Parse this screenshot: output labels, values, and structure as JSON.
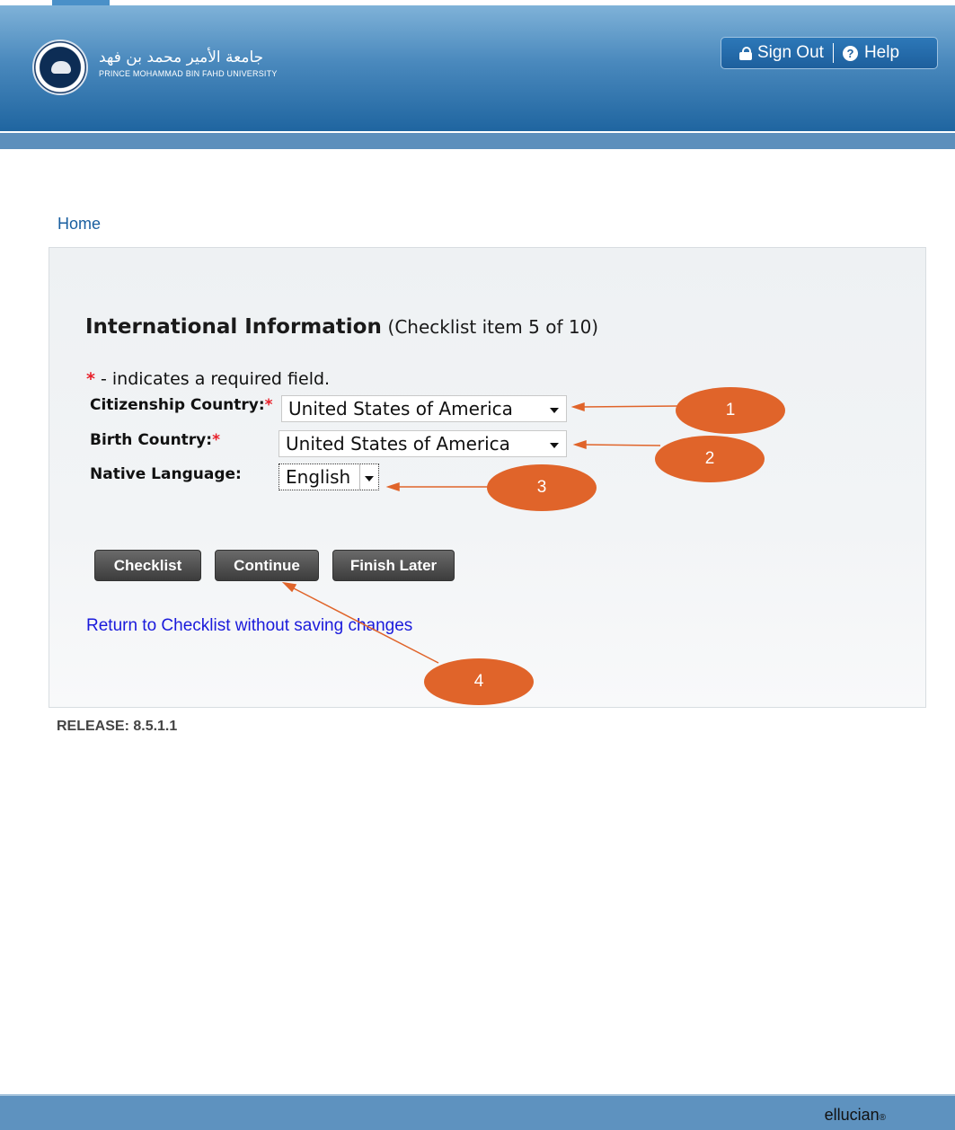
{
  "header": {
    "university_ar": "جامعة الأمير محمد بن فهد",
    "university_en": "PRINCE MOHAMMAD BIN FAHD UNIVERSITY",
    "sign_out": "Sign Out",
    "help": "Help"
  },
  "breadcrumb": "Home",
  "page": {
    "title": "International Information",
    "subtitle": "(Checklist item 5 of 10)",
    "required_note": " - indicates a required field."
  },
  "fields": {
    "citizenship": {
      "label": "Citizenship Country:",
      "value": "United States of America"
    },
    "birth": {
      "label": "Birth Country:",
      "value": "United States of America"
    },
    "language": {
      "label": "Native Language:",
      "value": "English"
    }
  },
  "buttons": {
    "checklist": "Checklist",
    "continue": "Continue",
    "finish_later": "Finish Later"
  },
  "return_link": "Return to Checklist without saving changes",
  "release": "RELEASE: 8.5.1.1",
  "footer": {
    "brand": "ellucian",
    "reg": "®"
  },
  "callouts": [
    "1",
    "2",
    "3",
    "4"
  ],
  "colors": {
    "accent_orange": "#e0642a",
    "header_blue": "#1f65a0",
    "link_blue": "#1a1adb",
    "required_red": "#e8202a"
  }
}
